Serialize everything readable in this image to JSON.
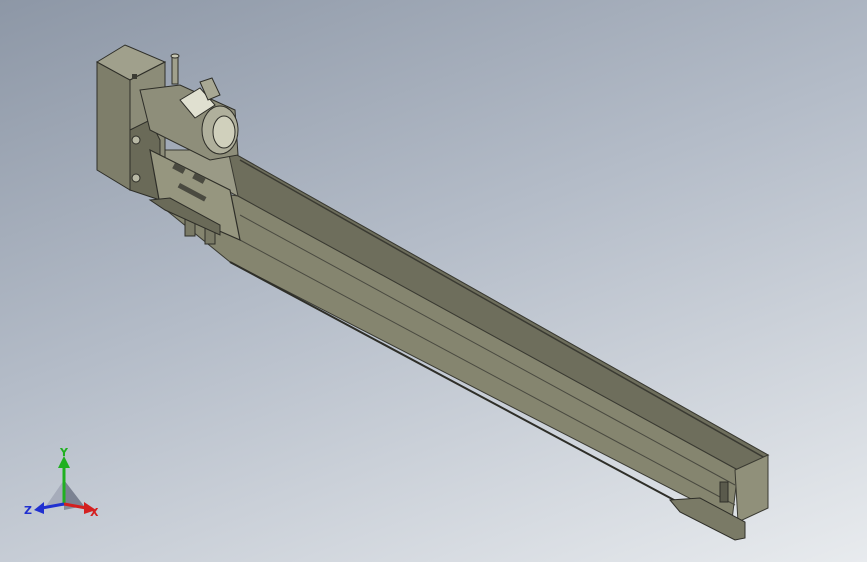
{
  "viewport": {
    "background_top": "#8d97a6",
    "background_bottom": "#e8ebee"
  },
  "model": {
    "body_color": "#8a8a76",
    "dark_color": "#4a4a40",
    "light_color": "#b8b8a4"
  },
  "triad": {
    "x_label": "X",
    "y_label": "Y",
    "z_label": "Z",
    "x_color": "#d42020",
    "y_color": "#20b020",
    "z_color": "#2030d0"
  }
}
